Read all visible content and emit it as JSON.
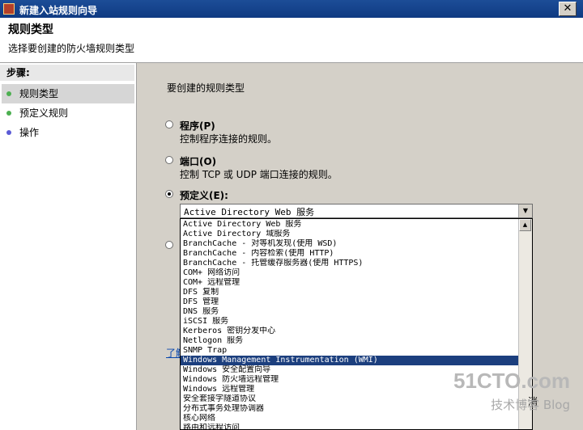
{
  "window": {
    "title": "新建入站规则向导",
    "close_glyph": "✕"
  },
  "header": {
    "title": "规则类型",
    "subtitle": "选择要创建的防火墙规则类型"
  },
  "steps": {
    "heading": "步骤:",
    "items": [
      {
        "label": "规则类型",
        "color": "#4caf50"
      },
      {
        "label": "预定义规则",
        "color": "#4caf50"
      },
      {
        "label": "操作",
        "color": "#5b5bd6"
      }
    ]
  },
  "main": {
    "prompt": "要创建的规则类型",
    "options": [
      {
        "label": "程序(P)",
        "desc": "控制程序连接的规则。",
        "selected": false
      },
      {
        "label": "端口(O)",
        "desc": "控制 TCP 或 UDP 端口连接的规则。",
        "selected": false
      },
      {
        "label": "预定义(E):",
        "desc": "",
        "selected": true
      }
    ],
    "link_fragment": "了解",
    "cutoff_text": "消"
  },
  "combo": {
    "value": "Active Directory Web 服务",
    "arrow_glyph": "▼",
    "items": [
      "Active Directory Web 服务",
      "Active Directory 域服务",
      "BranchCache - 对等机发现(使用 WSD)",
      "BranchCache - 内容检索(使用 HTTP)",
      "BranchCache - 托管缓存服务器(使用 HTTPS)",
      "COM+ 网络访问",
      "COM+ 远程管理",
      "DFS 复制",
      "DFS 管理",
      "DNS 服务",
      "iSCSI 服务",
      "Kerberos 密钥分发中心",
      "Netlogon 服务",
      "SNMP Trap",
      "Windows Management Instrumentation (WMI)",
      "Windows 安全配置向导",
      "Windows 防火墙远程管理",
      "Windows 远程管理",
      "安全套接字隧道协议",
      "分布式事务处理协调器",
      "核心网络",
      "路由和远程访问"
    ],
    "highlighted_index": 14,
    "scroll_up_glyph": "▲",
    "scroll_down_glyph": "▼"
  },
  "watermark": {
    "site": "51CTO.com",
    "tagline": "技术博客 Blog"
  }
}
